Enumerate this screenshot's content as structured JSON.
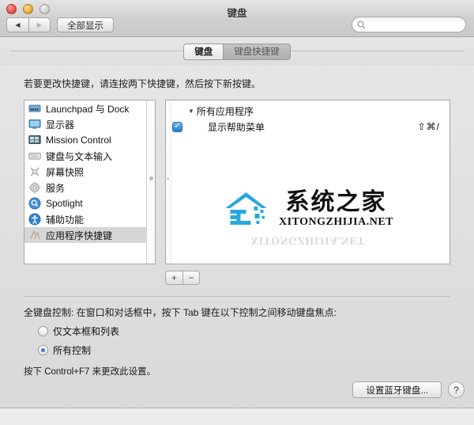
{
  "window": {
    "title": "键盘",
    "traffic_lights": [
      "close-button",
      "minimize-button",
      "zoom-button"
    ],
    "back_label": "◀",
    "forward_label": "▶",
    "show_all_label": "全部显示",
    "search_value": "",
    "search_placeholder": ""
  },
  "tabs": [
    {
      "label": "键盘",
      "selected": true
    },
    {
      "label": "键盘快捷键",
      "selected": false
    }
  ],
  "hint": "若要更改快捷键，请连按两下快捷键，然后按下新按键。",
  "sidebar": {
    "items": [
      {
        "label": "Launchpad 与 Dock",
        "icon": "dock-icon",
        "selected": false
      },
      {
        "label": "显示器",
        "icon": "display-icon",
        "selected": false
      },
      {
        "label": "Mission Control",
        "icon": "mission-control-icon",
        "selected": false
      },
      {
        "label": "键盘与文本输入",
        "icon": "keyboard-icon",
        "selected": false
      },
      {
        "label": "屏幕快照",
        "icon": "screenshot-icon",
        "selected": false
      },
      {
        "label": "服务",
        "icon": "gear-icon",
        "selected": false
      },
      {
        "label": "Spotlight",
        "icon": "spotlight-icon",
        "selected": false
      },
      {
        "label": "辅助功能",
        "icon": "accessibility-icon",
        "selected": false
      },
      {
        "label": "应用程序快捷键",
        "icon": "app-shortcuts-icon",
        "selected": true
      }
    ]
  },
  "shortcut_list": {
    "group_label": "所有应用程序",
    "disclosure": "▼",
    "rows": [
      {
        "checked": true,
        "label": "显示帮助菜单",
        "keys": "⇧⌘/"
      }
    ],
    "add_label": "+",
    "remove_label": "−"
  },
  "watermark": {
    "cn": "系统之家",
    "en": "XITONGZHIJIA.NET"
  },
  "full_keyboard_access": {
    "title": "全键盘控制: 在窗口和对话框中，按下 Tab 键在以下控制之间移动键盘焦点:",
    "options": [
      {
        "label": "仅文本框和列表",
        "selected": false
      },
      {
        "label": "所有控制",
        "selected": true
      }
    ],
    "note": "按下 Control+F7 来更改此设置。"
  },
  "footer": {
    "bluetooth_label": "设置蓝牙键盘...",
    "help_label": "?"
  },
  "colors": {
    "accent": "#3b7fd4",
    "checkbox": "#2b7fc4",
    "window_bg": "#e8e8e8",
    "logo_blue": "#29a8dd"
  }
}
